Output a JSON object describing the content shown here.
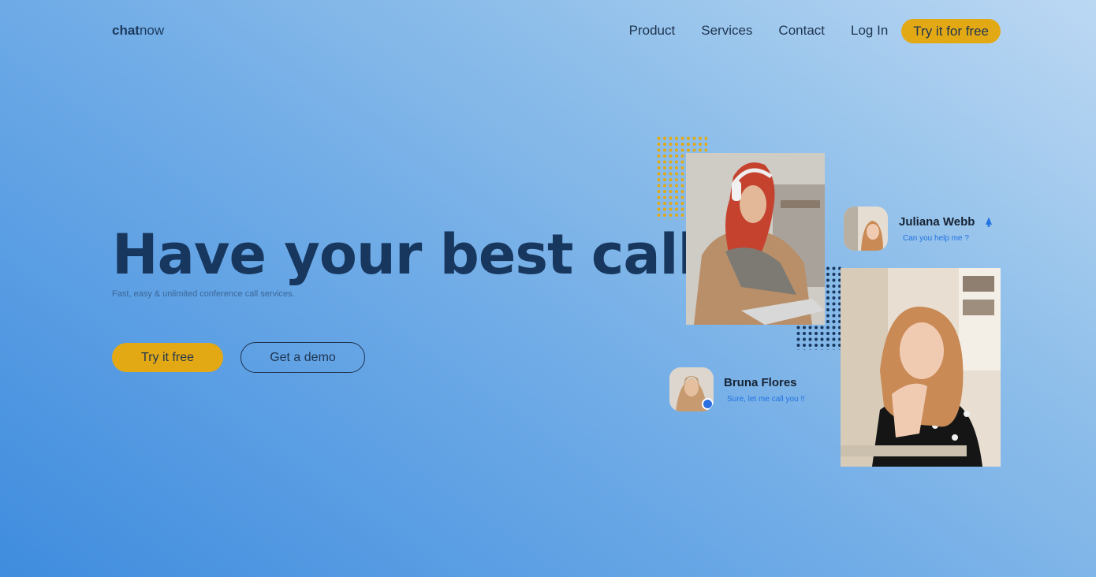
{
  "brand": {
    "bold": "chat",
    "light": "now"
  },
  "nav": {
    "items": [
      "Product",
      "Services",
      "Contact",
      "Log In"
    ],
    "cta": "Try it for free"
  },
  "hero": {
    "title": "Have your best call",
    "subtitle": "Fast, easy & unlimited conference call services.",
    "primary_button": "Try it free",
    "secondary_button": "Get a demo"
  },
  "cards": [
    {
      "name": "Juliana Webb",
      "message": "Can you help me ?",
      "icon": "bell-icon"
    },
    {
      "name": "Bruna Flores",
      "message": "Sure, let me call you !!",
      "icon": "online-status-dot"
    }
  ],
  "colors": {
    "accent": "#e3a914",
    "heading": "#17375e",
    "link_blue": "#2272e0"
  }
}
